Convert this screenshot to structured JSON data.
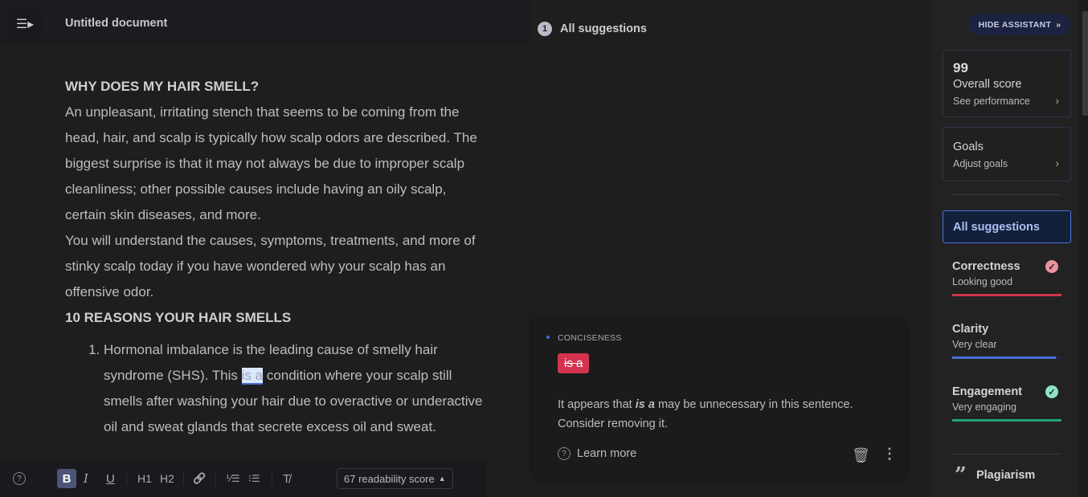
{
  "header": {
    "title": "Untitled document",
    "menu_icon": "menu-icon"
  },
  "document": {
    "heading1": "WHY DOES MY HAIR SMELL?",
    "para1": "An unpleasant, irritating stench that seems to be coming from the head, hair, and scalp is typically how scalp odors are described. The biggest surprise is that it may not always be due to improper scalp cleanliness; other possible causes include having an oily scalp, certain skin diseases, and more.",
    "para2": "You will understand the causes, symptoms, treatments, and more of stinky scalp today if you have wondered why your scalp has an offensive odor.",
    "heading2": "10 REASONS YOUR HAIR SMELLS",
    "list": [
      {
        "before": "Hormonal imbalance is the leading cause of smelly hair syndrome (SHS). This ",
        "highlight": "is a",
        "after": " condition where your scalp still smells after washing your hair due to overactive or underactive oil and sweat glands that secrete excess oil and sweat."
      }
    ]
  },
  "toolbar": {
    "help": "?",
    "bold": "B",
    "italic": "I",
    "underline": "U",
    "h1": "H1",
    "h2": "H2",
    "link": "🔗",
    "ordered": "⅟☰",
    "bullets": "⁝☰",
    "clear": "T̸",
    "readability": "67 readability score",
    "readability_arrow": "▲"
  },
  "suggestions": {
    "count": "1",
    "title": "All suggestions",
    "card": {
      "category": "CONCISENESS",
      "removed": "is a",
      "msg_before": "It appears that ",
      "msg_bold": "is a",
      "msg_after": " may be unnecessary in this sentence. Consider removing it.",
      "learn_more": "Learn more"
    }
  },
  "assistant": {
    "hide": "HIDE ASSISTANT",
    "score": {
      "value": "99",
      "title": "Overall score",
      "sub": "See performance"
    },
    "goals": {
      "title": "Goals",
      "sub": "Adjust goals"
    },
    "all_suggestions": "All suggestions",
    "metrics": [
      {
        "title": "Correctness",
        "sub": "Looking good",
        "color": "#d2344e",
        "check_color": "#e8929e",
        "fill": 100,
        "checked": true
      },
      {
        "title": "Clarity",
        "sub": "Very clear",
        "color": "#4a6fd8",
        "fill": 95,
        "checked": false
      },
      {
        "title": "Engagement",
        "sub": "Very engaging",
        "color": "#1fa37a",
        "check_color": "#8de3c8",
        "fill": 100,
        "checked": true
      }
    ],
    "plagiarism": "Plagiarism"
  }
}
